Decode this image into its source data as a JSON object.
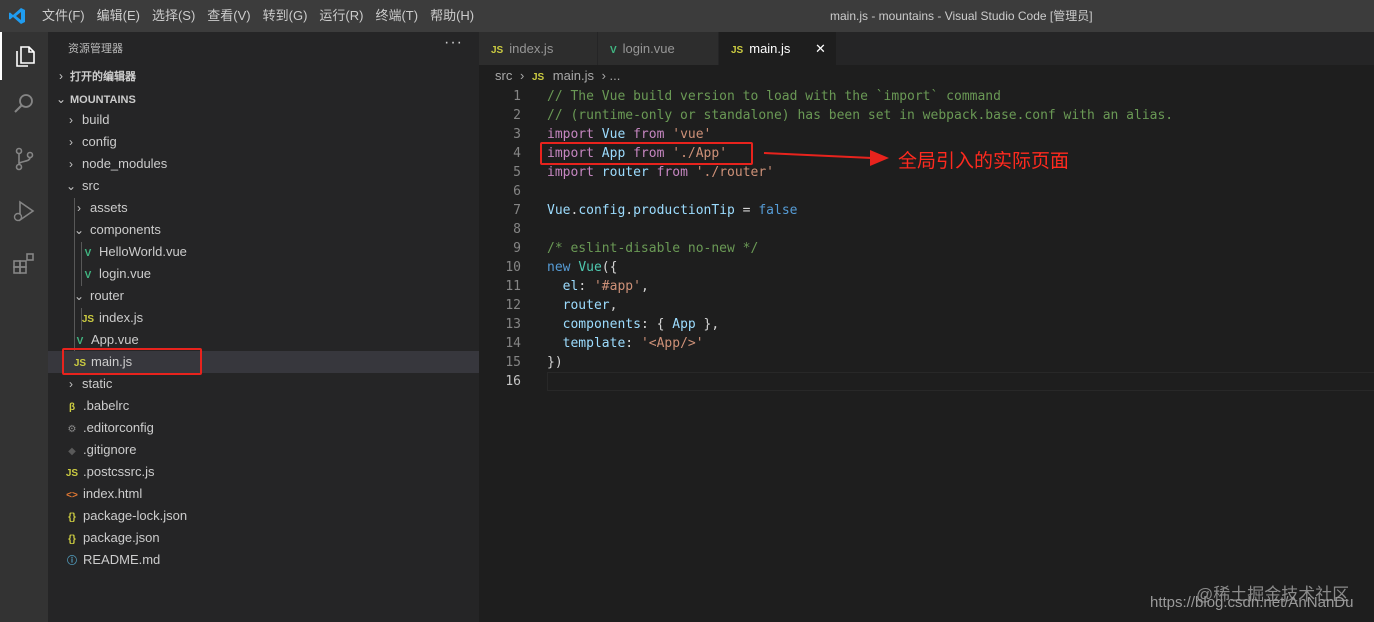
{
  "titlebar": {
    "menu": [
      "文件(F)",
      "编辑(E)",
      "选择(S)",
      "查看(V)",
      "转到(G)",
      "运行(R)",
      "终端(T)",
      "帮助(H)"
    ],
    "window_title": "main.js - mountains - Visual Studio Code [管理员]"
  },
  "activity_bar": [
    "explorer-icon",
    "search-icon",
    "source-control-icon",
    "run-debug-icon",
    "extensions-icon"
  ],
  "sidebar": {
    "title": "资源管理器",
    "more": "···",
    "open_editors": "打开的编辑器",
    "project": "MOUNTAINS",
    "tree": [
      {
        "label": "build",
        "kind": "folder",
        "depth": 0,
        "expanded": false
      },
      {
        "label": "config",
        "kind": "folder",
        "depth": 0,
        "expanded": false
      },
      {
        "label": "node_modules",
        "kind": "folder",
        "depth": 0,
        "expanded": false
      },
      {
        "label": "src",
        "kind": "folder",
        "depth": 0,
        "expanded": true
      },
      {
        "label": "assets",
        "kind": "folder",
        "depth": 1,
        "expanded": false
      },
      {
        "label": "components",
        "kind": "folder",
        "depth": 1,
        "expanded": true
      },
      {
        "label": "HelloWorld.vue",
        "kind": "vue",
        "depth": 2
      },
      {
        "label": "login.vue",
        "kind": "vue",
        "depth": 2
      },
      {
        "label": "router",
        "kind": "folder",
        "depth": 1,
        "expanded": true
      },
      {
        "label": "index.js",
        "kind": "js",
        "depth": 2
      },
      {
        "label": "App.vue",
        "kind": "vue",
        "depth": 1
      },
      {
        "label": "main.js",
        "kind": "js",
        "depth": 1,
        "selected": true
      },
      {
        "label": "static",
        "kind": "folder",
        "depth": 0,
        "expanded": false
      },
      {
        "label": ".babelrc",
        "kind": "babel",
        "depth": 0
      },
      {
        "label": ".editorconfig",
        "kind": "gear",
        "depth": 0
      },
      {
        "label": ".gitignore",
        "kind": "git",
        "depth": 0
      },
      {
        "label": ".postcssrc.js",
        "kind": "js",
        "depth": 0
      },
      {
        "label": "index.html",
        "kind": "html",
        "depth": 0
      },
      {
        "label": "package-lock.json",
        "kind": "json",
        "depth": 0
      },
      {
        "label": "package.json",
        "kind": "json",
        "depth": 0
      },
      {
        "label": "README.md",
        "kind": "info",
        "depth": 0
      }
    ]
  },
  "tabs": [
    {
      "label": "index.js",
      "icon": "JS",
      "active": false
    },
    {
      "label": "login.vue",
      "icon": "V",
      "active": false
    },
    {
      "label": "main.js",
      "icon": "JS",
      "active": true,
      "close": "✕"
    }
  ],
  "breadcrumb": {
    "folder": "src",
    "sep": "›",
    "icon": "JS",
    "file": "main.js",
    "tail": "› ..."
  },
  "editor": {
    "current_line": 16,
    "lines": [
      [
        [
          "c",
          "// The Vue build version to load with the `import` command"
        ]
      ],
      [
        [
          "c",
          "// (runtime-only or standalone) has been set in webpack.base.conf with an alias."
        ]
      ],
      [
        [
          "k",
          "import "
        ],
        [
          "v",
          "Vue "
        ],
        [
          "k",
          "from "
        ],
        [
          "s",
          "'vue'"
        ]
      ],
      [
        [
          "k",
          "import "
        ],
        [
          "v",
          "App "
        ],
        [
          "k",
          "from "
        ],
        [
          "s",
          "'./App'"
        ]
      ],
      [
        [
          "k",
          "import "
        ],
        [
          "v",
          "router "
        ],
        [
          "k",
          "from "
        ],
        [
          "s",
          "'./router'"
        ]
      ],
      [],
      [
        [
          "v",
          "Vue"
        ],
        [
          "p",
          "."
        ],
        [
          "v",
          "config"
        ],
        [
          "p",
          "."
        ],
        [
          "v",
          "productionTip"
        ],
        [
          "p",
          " = "
        ],
        [
          "b",
          "false"
        ]
      ],
      [],
      [
        [
          "c",
          "/* eslint-disable no-new */"
        ]
      ],
      [
        [
          "b",
          "new "
        ],
        [
          "t",
          "Vue"
        ],
        [
          "p",
          "({"
        ]
      ],
      [
        [
          "p",
          "  "
        ],
        [
          "v",
          "el"
        ],
        [
          "p",
          ": "
        ],
        [
          "s",
          "'#app'"
        ],
        [
          "p",
          ","
        ]
      ],
      [
        [
          "p",
          "  "
        ],
        [
          "v",
          "router"
        ],
        [
          "p",
          ","
        ]
      ],
      [
        [
          "p",
          "  "
        ],
        [
          "v",
          "components"
        ],
        [
          "p",
          ": { "
        ],
        [
          "v",
          "App"
        ],
        [
          "p",
          " },"
        ]
      ],
      [
        [
          "p",
          "  "
        ],
        [
          "v",
          "template"
        ],
        [
          "p",
          ": "
        ],
        [
          "s",
          "'<App/>'"
        ]
      ],
      [
        [
          "p",
          "})"
        ]
      ],
      []
    ]
  },
  "annotation": {
    "text": "全局引入的实际页面",
    "color": "#e8231d"
  },
  "watermark": {
    "line1": "@稀土掘金技术社区",
    "line2": "https://blog.csdn.net/AnNanDu"
  }
}
